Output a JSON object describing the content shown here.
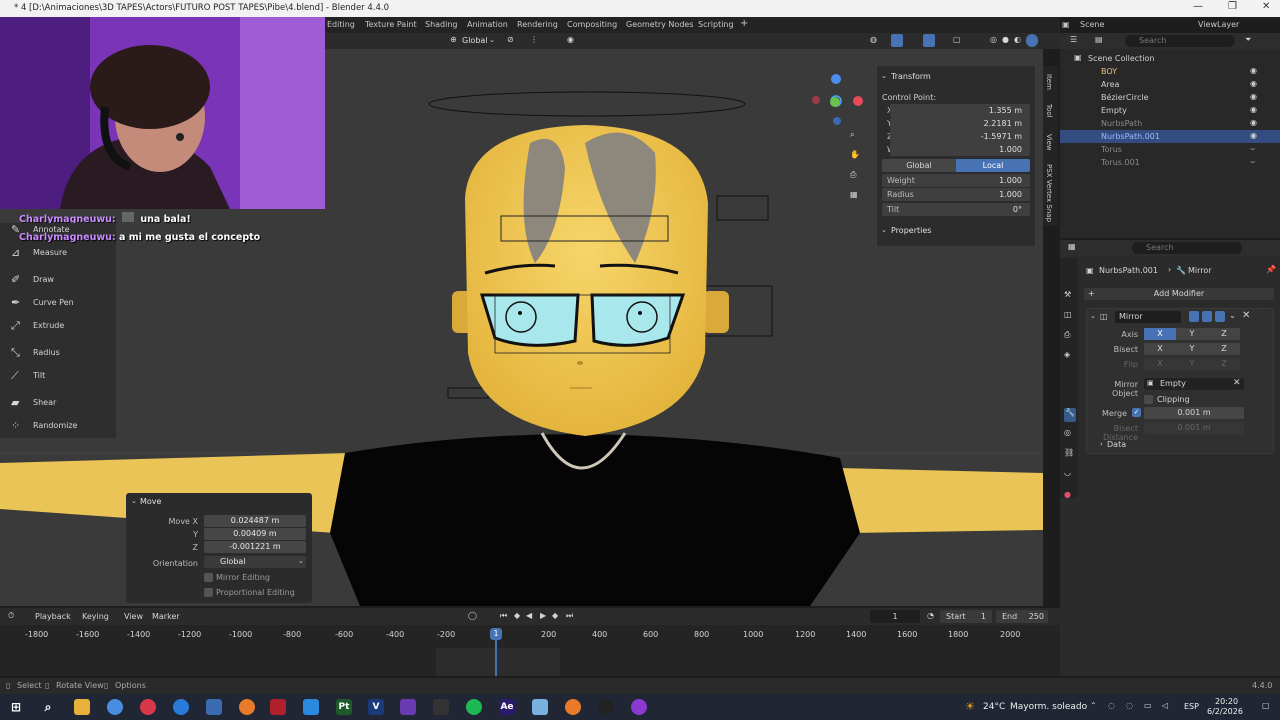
{
  "window": {
    "title": "* 4 [D:\\Animaciones\\3D TAPES\\Actors\\FUTURO POST TAPES\\Pibe\\4.blend] - Blender 4.4.0"
  },
  "menubar": {
    "workspaces": [
      "Editing",
      "Texture Paint",
      "Shading",
      "Animation",
      "Rendering",
      "Compositing",
      "Geometry Nodes",
      "Scripting"
    ],
    "scene": "Scene",
    "view_layer": "ViewLayer"
  },
  "viewport_header": {
    "transform_orientation": "Global"
  },
  "chat": [
    {
      "user": "Charlymagneuwu:",
      "message": "una bala!"
    },
    {
      "user": "Charlymagneuwu:",
      "message": "a mi me gusta el concepto"
    }
  ],
  "tools": [
    "Annotate",
    "Measure",
    "Draw",
    "Curve Pen",
    "Extrude",
    "Radius",
    "Tilt",
    "Shear",
    "Randomize"
  ],
  "transform_panel": {
    "title": "Transform",
    "control_point_label": "Control Point:",
    "fields": [
      {
        "label": "X",
        "value": "1.355 m"
      },
      {
        "label": "Y",
        "value": "2.2181 m"
      },
      {
        "label": "Z",
        "value": "-1.5971 m"
      },
      {
        "label": "W",
        "value": "1.000"
      }
    ],
    "space_options": [
      "Global",
      "Local"
    ],
    "active_space": "Local",
    "extra": [
      {
        "label": "Weight",
        "value": "1.000"
      },
      {
        "label": "Radius",
        "value": "1.000"
      },
      {
        "label": "Tilt",
        "value": "0°"
      }
    ],
    "properties_label": "Properties"
  },
  "side_tabs": [
    "Item",
    "Tool",
    "View",
    "PSX Vertex Snap"
  ],
  "move_panel": {
    "title": "Move",
    "move_x_label": "Move X",
    "x": "0.024487 m",
    "y_label": "Y",
    "y": "0.00409 m",
    "z_label": "Z",
    "z": "-0.001221 m",
    "orientation_label": "Orientation",
    "orientation": "Global",
    "mirror_editing": "Mirror Editing",
    "proportional_editing": "Proportional Editing"
  },
  "outliner": {
    "search_placeholder": "Search",
    "root": "Scene Collection",
    "items": [
      "BOY",
      "Area",
      "BézierCircle",
      "Empty",
      "NurbsPath",
      "NurbsPath.001",
      "Torus",
      "Torus.001"
    ],
    "selected": "NurbsPath.001"
  },
  "properties": {
    "search_placeholder": "Search",
    "object": "NurbsPath.001",
    "modifier_crumb": "Mirror",
    "add_modifier": "Add Modifier",
    "modifier_name": "Mirror",
    "axis_label": "Axis",
    "bisect_label": "Bisect",
    "flip_label": "Flip",
    "axes": [
      "X",
      "Y",
      "Z"
    ],
    "mirror_object_label": "Mirror Object",
    "mirror_object": "Empty",
    "clipping": "Clipping",
    "merge_label": "Merge",
    "merge_value": "0.001 m",
    "bisect_distance_label": "Bisect Distance",
    "bisect_distance": "0.001 m",
    "data_label": "Data"
  },
  "timeline": {
    "menus": [
      "Playback",
      "Keying",
      "View",
      "Marker"
    ],
    "current_frame": "1",
    "start_label": "Start",
    "start": "1",
    "end_label": "End",
    "end": "250",
    "ruler": [
      "-1800",
      "-1600",
      "-1400",
      "-1200",
      "-1000",
      "-800",
      "-600",
      "-400",
      "-200",
      "200",
      "400",
      "600",
      "800",
      "1000",
      "1200",
      "1400",
      "1600",
      "1800",
      "2000"
    ],
    "playhead": "1"
  },
  "statusbar": {
    "select": "Select",
    "rotate": "Rotate View",
    "options": "Options",
    "version": "4.4.0"
  },
  "taskbar": {
    "weather_temp": "24°C",
    "weather_text": "Mayorm. soleado",
    "lang": "ESP",
    "time": "20:20",
    "date": "6/2/2026"
  }
}
